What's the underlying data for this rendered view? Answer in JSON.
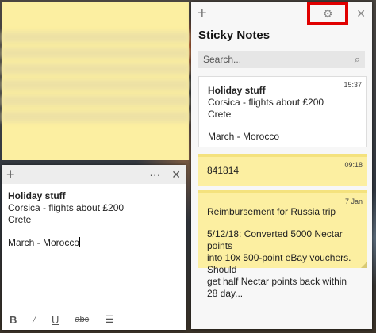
{
  "editor": {
    "title": "Holiday stuff",
    "lines": [
      "Corsica - flights about £200",
      "Crete",
      "March - Morocco"
    ],
    "toolbar": {
      "new": "+",
      "more": "···",
      "close": "✕"
    },
    "format": {
      "bold": "B",
      "italic": "/",
      "underline": "U",
      "strike": "abc",
      "list": "☰"
    }
  },
  "panel": {
    "new": "+",
    "settings_icon": "⚙",
    "close": "✕",
    "title": "Sticky Notes",
    "search_placeholder": "Search...",
    "search_icon": "⌕"
  },
  "notes": [
    {
      "time": "15:37",
      "title": "Holiday stuff",
      "lines": [
        "Corsica - flights about £200",
        "Crete",
        "March - Morocco"
      ]
    },
    {
      "time": "09:18",
      "text": "841814"
    },
    {
      "time": "7 Jan",
      "line1": "Reimbursement for Russia trip",
      "line2": "5/12/18: Converted 5000 Nectar points",
      "line3": "into 10x 500-point eBay vouchers. Should",
      "line4": "get half Nectar points back within 28 day..."
    }
  ],
  "colors": {
    "highlight": "#e00000",
    "note_yellow": "#fcefa1"
  }
}
